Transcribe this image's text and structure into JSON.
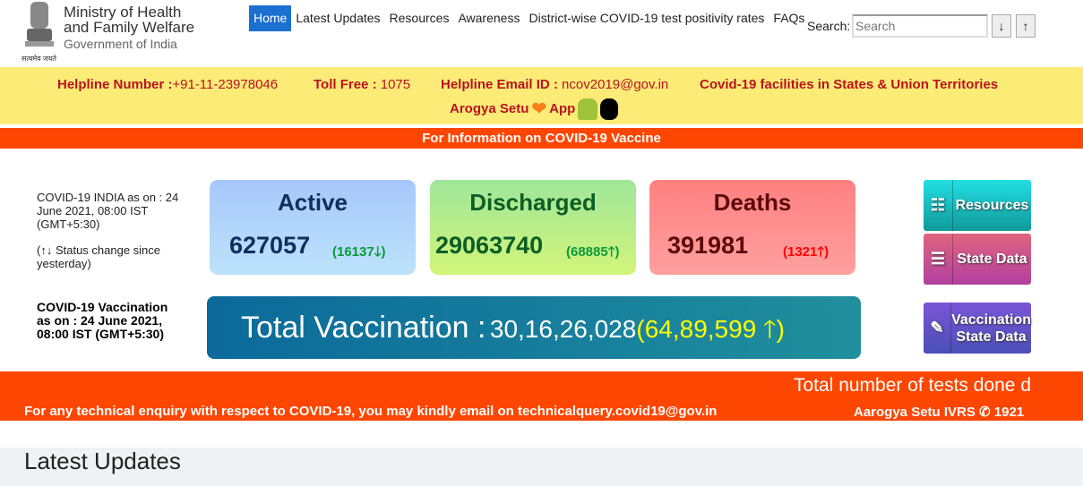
{
  "header": {
    "ministry_line1": "Ministry of Health",
    "ministry_line2": "and Family Welfare",
    "government": "Government of India",
    "motto": "सत्यमेव जयते"
  },
  "nav": {
    "items": [
      "Home",
      "Latest Updates",
      "Resources",
      "Awareness",
      "District-wise COVID-19 test positivity rates",
      "FAQs"
    ],
    "active": "Home"
  },
  "search": {
    "label": "Search:",
    "placeholder": "Search",
    "down": "↓",
    "up": "↑"
  },
  "helpline": {
    "number_label": "Helpline Number :",
    "number": "+91-11-23978046",
    "tollfree_label": "Toll Free :",
    "tollfree": "1075",
    "email_label": "Helpline Email ID :",
    "email": "ncov2019@gov.in",
    "facilities": "Covid-19 facilities in States & Union Territories",
    "arogya": "Arogya Setu",
    "app": "App"
  },
  "vaccine_banner": "For Information on COVID-19 Vaccine",
  "status": {
    "as_on": "COVID-19 INDIA as on : 24 June 2021, 08:00 IST (GMT+5:30)",
    "legend": "(↑↓ Status change since yesterday)"
  },
  "cards": [
    {
      "title": "Active",
      "value": "627057",
      "change": "(16137🡓)",
      "bg": "#aecbf9",
      "title_color": "#0c2f5c",
      "change_color": "#0a9a3a"
    },
    {
      "title": "Discharged",
      "value": "29063740",
      "change": "(68885🡑)",
      "bg": "#a8e893",
      "title_color": "#0b5e24",
      "change_color": "#0a9a3a"
    },
    {
      "title": "Deaths",
      "value": "391981",
      "change": "(1321🡑)",
      "bg": "#ff8a8a",
      "title_color": "#5c0909",
      "change_color": "#ff0000"
    }
  ],
  "vaccination": {
    "as_on": "COVID-19 Vaccination as on : 24 June 2021, 08:00 IST (GMT+5:30)",
    "label": "Total Vaccination :",
    "total": "30,16,26,028",
    "change": "(64,89,599 🡑)"
  },
  "tiles": [
    {
      "label": "Resources"
    },
    {
      "label": "State Data"
    },
    {
      "label": "Vaccination State Data"
    }
  ],
  "ticker": {
    "tests": "Total number of tests done d",
    "enquiry": "For any technical enquiry with respect to COVID-19, you may kindly email on technicalquery.covid19@gov.in",
    "ivrs": "Aarogya Setu IVRS ✆ 1921"
  },
  "latest": {
    "title": "Latest Updates"
  }
}
